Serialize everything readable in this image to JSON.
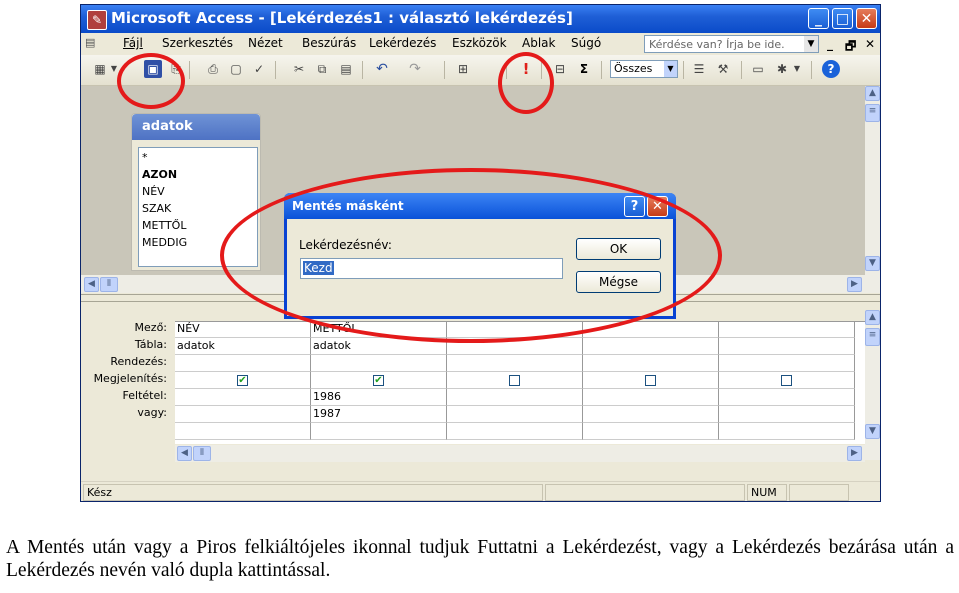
{
  "window": {
    "title": "Microsoft Access - [Lekérdezés1 : választó lekérdezés]",
    "minimize_glyph": "_",
    "maximize_glyph": "□",
    "close_glyph": "✕"
  },
  "menu": {
    "items": [
      "Fájl",
      "Szerkesztés",
      "Nézet",
      "Beszúrás",
      "Lekérdezés",
      "Eszközök",
      "Ablak",
      "Súgó"
    ],
    "ask_placeholder": "Kérdése van? Írja be ide.",
    "mdi_min": "_",
    "mdi_restore": "🗗",
    "mdi_close": "✕"
  },
  "toolbar": {
    "sum_glyph": "Σ",
    "run_glyph": "!",
    "combo_value": "Összes",
    "help_glyph": "?"
  },
  "table": {
    "name": "adatok",
    "fields": [
      "*",
      "AZON",
      "NÉV",
      "SZAK",
      "METTŐL",
      "MEDDIG"
    ]
  },
  "grid": {
    "row_labels": [
      "Mező:",
      "Tábla:",
      "Rendezés:",
      "Megjelenítés:",
      "Feltétel:",
      "vagy:"
    ],
    "columns": [
      {
        "field": "NÉV",
        "table": "adatok",
        "show": true,
        "criteria": "",
        "or": ""
      },
      {
        "field": "METTŐL",
        "table": "adatok",
        "show": true,
        "criteria": "1986",
        "or": "1987"
      },
      {
        "field": "",
        "table": "",
        "show": false,
        "criteria": "",
        "or": ""
      },
      {
        "field": "",
        "table": "",
        "show": false,
        "criteria": "",
        "or": ""
      },
      {
        "field": "",
        "table": "",
        "show": false,
        "criteria": "",
        "or": ""
      }
    ]
  },
  "dialog": {
    "title": "Mentés másként",
    "label": "Lekérdezésnév:",
    "value": "Kezd",
    "ok_label": "OK",
    "cancel_label": "Mégse",
    "help_glyph": "?",
    "close_glyph": "✕"
  },
  "statusbar": {
    "text": "Kész",
    "num": "NUM"
  },
  "colors": {
    "annotation": "#e41a1a",
    "xp_blue": "#0a52d8"
  },
  "caption": "A Mentés után vagy a Piros felkiáltójeles ikonnal tudjuk Futtatni a Lekérdezést, vagy a Lekérdezés bezárása után a Lekérdezés nevén való dupla kattintással."
}
